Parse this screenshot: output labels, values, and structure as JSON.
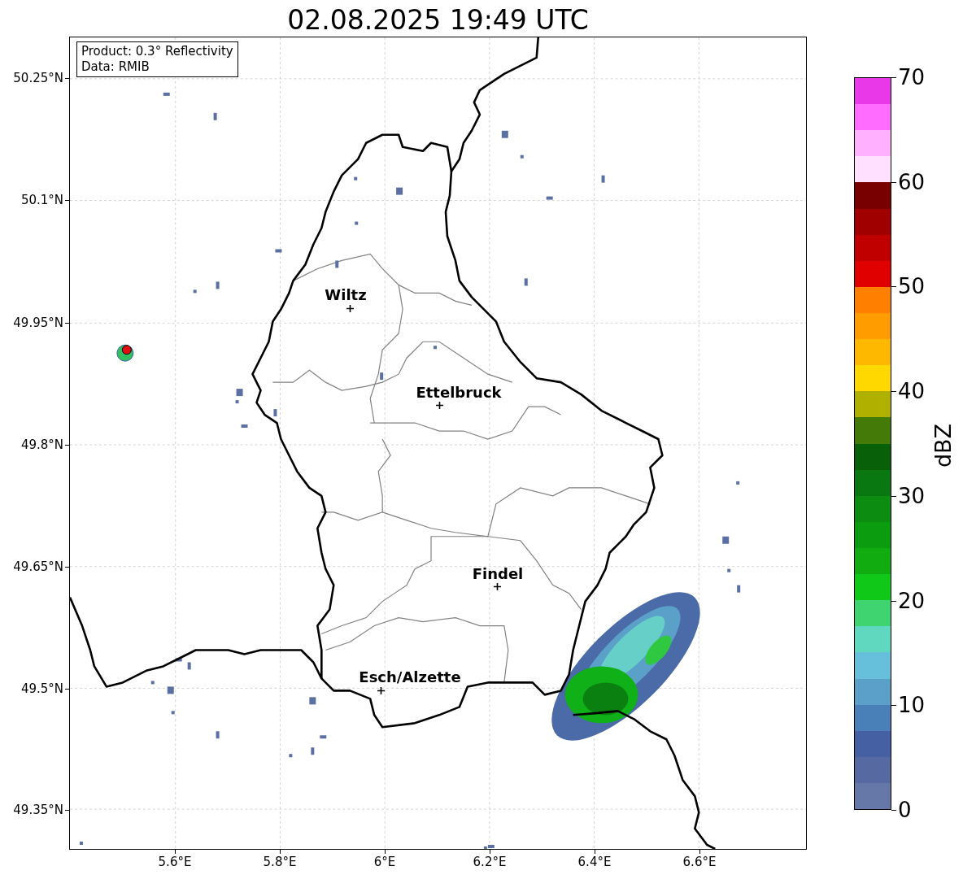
{
  "title": "02.08.2025 19:49 UTC",
  "map": {
    "info_lines": [
      "Product: 0.3° Reflectivity",
      "Data: RMIB"
    ],
    "cities": [
      {
        "name": "Wiltz"
      },
      {
        "name": "Ettelbruck"
      },
      {
        "name": "Findel"
      },
      {
        "name": "Esch/Alzette"
      }
    ],
    "x_ticks": [
      "5.6°E",
      "5.8°E",
      "6°E",
      "6.2°E",
      "6.4°E",
      "6.6°E"
    ],
    "y_ticks": [
      "50.25°N",
      "50.1°N",
      "49.95°N",
      "49.8°N",
      "49.65°N",
      "49.5°N",
      "49.35°N"
    ]
  },
  "colorbar": {
    "label": "dBZ",
    "ticks": [
      "70",
      "60",
      "50",
      "40",
      "30",
      "20",
      "10",
      "0"
    ],
    "bins": [
      {
        "color": "#e838e8"
      },
      {
        "color": "#ff6cff"
      },
      {
        "color": "#ffb0ff"
      },
      {
        "color": "#ffe0ff"
      },
      {
        "color": "#780000"
      },
      {
        "color": "#a00000"
      },
      {
        "color": "#c00000"
      },
      {
        "color": "#e00000"
      },
      {
        "color": "#ff8000"
      },
      {
        "color": "#ff9c00"
      },
      {
        "color": "#ffb800"
      },
      {
        "color": "#ffd800"
      },
      {
        "color": "#b0b000"
      },
      {
        "color": "#447a08"
      },
      {
        "color": "#086008"
      },
      {
        "color": "#0a7810"
      },
      {
        "color": "#0c8c10"
      },
      {
        "color": "#0c9c10"
      },
      {
        "color": "#10ac10"
      },
      {
        "color": "#10c818"
      },
      {
        "color": "#40d470"
      },
      {
        "color": "#60d8c0"
      },
      {
        "color": "#66c0dc"
      },
      {
        "color": "#5aa0c8"
      },
      {
        "color": "#4a80b8"
      },
      {
        "color": "#4560a3"
      },
      {
        "color": "#5669a0"
      },
      {
        "color": "#6678a8"
      }
    ]
  }
}
